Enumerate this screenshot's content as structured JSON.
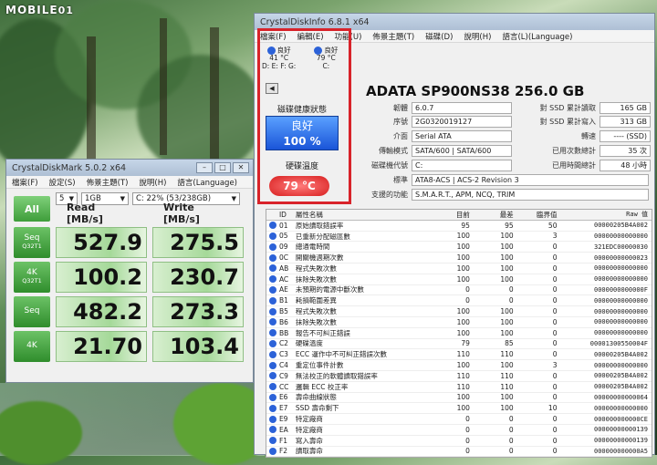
{
  "watermark": {
    "brand": "MOBILE",
    "suffix": "01"
  },
  "cdm": {
    "title": "CrystalDiskMark 5.0.2 x64",
    "menu": [
      "檔案(F)",
      "設定(S)",
      "佈景主題(T)",
      "說明(H)",
      "語言(Language)"
    ],
    "count": "5",
    "size": "1GB",
    "drive": "C: 22% (53/238GB)",
    "all_label": "All",
    "read_header": "Read [MB/s]",
    "write_header": "Write [MB/s]",
    "rows": [
      {
        "label": "Seq",
        "sub": "Q32T1",
        "read": "527.9",
        "write": "275.5"
      },
      {
        "label": "4K",
        "sub": "Q32T1",
        "read": "100.2",
        "write": "230.7"
      },
      {
        "label": "Seq",
        "sub": "",
        "read": "482.2",
        "write": "273.3"
      },
      {
        "label": "4K",
        "sub": "",
        "read": "21.70",
        "write": "103.4"
      }
    ]
  },
  "cdi": {
    "title": "CrystalDiskInfo 6.8.1 x64",
    "menu": [
      "檔案(F)",
      "編輯(E)",
      "功能(U)",
      "佈景主題(T)",
      "磁碟(D)",
      "說明(H)",
      "語言(L)(Language)"
    ],
    "disks": [
      {
        "status": "良好",
        "temp": "41 °C",
        "letters": "D: E: F: G:"
      },
      {
        "status": "良好",
        "temp": "79 °C",
        "letters": "C:"
      }
    ],
    "model": "ADATA SP900NS38 256.0 GB",
    "health_label": "磁碟健康狀態",
    "health_status": "良好",
    "health_pct": "100 %",
    "temp_label": "硬碟溫度",
    "temp_value": "79 °C",
    "firmware_key": "韌體",
    "firmware": "6.0.7",
    "serial_key": "序號",
    "serial": "2G0320019127",
    "iface_key": "介面",
    "iface": "Serial ATA",
    "mode_key": "傳輸模式",
    "mode": "SATA/600 | SATA/600",
    "letter_key": "磁碟機代號",
    "letter": "C:",
    "std_key": "標準",
    "std": "ATA8-ACS | ACS-2 Revision 3",
    "feat_key": "支援的功能",
    "feat": "S.M.A.R.T., APM, NCQ, TRIM",
    "reads_key": "對 SSD 累計讀取",
    "reads": "165 GB",
    "writes_key": "對 SSD 累計寫入",
    "writes": "313 GB",
    "rpm_key": "轉速",
    "rpm": "---- (SSD)",
    "poc_key": "已用次數總計",
    "poc": "35 次",
    "poh_key": "已用時間總計",
    "poh": "48 小時",
    "headers": {
      "id": "ID",
      "name": "屬性名稱",
      "cur": "目前",
      "worst": "最差",
      "thr": "臨界值",
      "raw": "Raw 值"
    },
    "smart": [
      [
        "01",
        "原始讀取錯誤率",
        "95",
        "95",
        "50",
        "00000205B4A002"
      ],
      [
        "05",
        "已重新分配磁區數",
        "100",
        "100",
        "3",
        "00000000000000"
      ],
      [
        "09",
        "總通電時間",
        "100",
        "100",
        "0",
        "321EDC00000030"
      ],
      [
        "0C",
        "開關機週期次數",
        "100",
        "100",
        "0",
        "00000000000023"
      ],
      [
        "AB",
        "程式失敗次數",
        "100",
        "100",
        "0",
        "00000000000000"
      ],
      [
        "AC",
        "抹除失敗次數",
        "100",
        "100",
        "0",
        "00000000000000"
      ],
      [
        "AE",
        "未預期的電源中斷次數",
        "0",
        "0",
        "0",
        "0000000000000F"
      ],
      [
        "B1",
        "耗損範圍差異",
        "0",
        "0",
        "0",
        "00000000000000"
      ],
      [
        "B5",
        "程式失敗次數",
        "100",
        "100",
        "0",
        "00000000000000"
      ],
      [
        "B6",
        "抹除失敗次數",
        "100",
        "100",
        "0",
        "00000000000000"
      ],
      [
        "BB",
        "報告不可糾正錯誤",
        "100",
        "100",
        "0",
        "00000000000000"
      ],
      [
        "C2",
        "硬碟溫度",
        "79",
        "85",
        "0",
        "00001300550004F"
      ],
      [
        "C3",
        "ECC 運作中不可糾正錯誤次數",
        "110",
        "110",
        "0",
        "00000205B4A002"
      ],
      [
        "C4",
        "重定位事件計數",
        "100",
        "100",
        "3",
        "00000000000000"
      ],
      [
        "C9",
        "無法校正的軟體讀取錯誤率",
        "110",
        "110",
        "0",
        "00000205B4A002"
      ],
      [
        "CC",
        "邏輯 ECC 校正率",
        "110",
        "110",
        "0",
        "00000205B4A002"
      ],
      [
        "E6",
        "壽命曲線狀態",
        "100",
        "100",
        "0",
        "00000000000064"
      ],
      [
        "E7",
        "SSD 壽命剩下",
        "100",
        "100",
        "10",
        "00000000000000"
      ],
      [
        "E9",
        "特定廠商",
        "0",
        "0",
        "0",
        "000000000000CE"
      ],
      [
        "EA",
        "特定廠商",
        "0",
        "0",
        "0",
        "00000000000139"
      ],
      [
        "F1",
        "寫入壽命",
        "0",
        "0",
        "0",
        "00000000000139"
      ],
      [
        "F2",
        "讀取壽命",
        "0",
        "0",
        "0",
        "000000000000A5"
      ]
    ]
  }
}
